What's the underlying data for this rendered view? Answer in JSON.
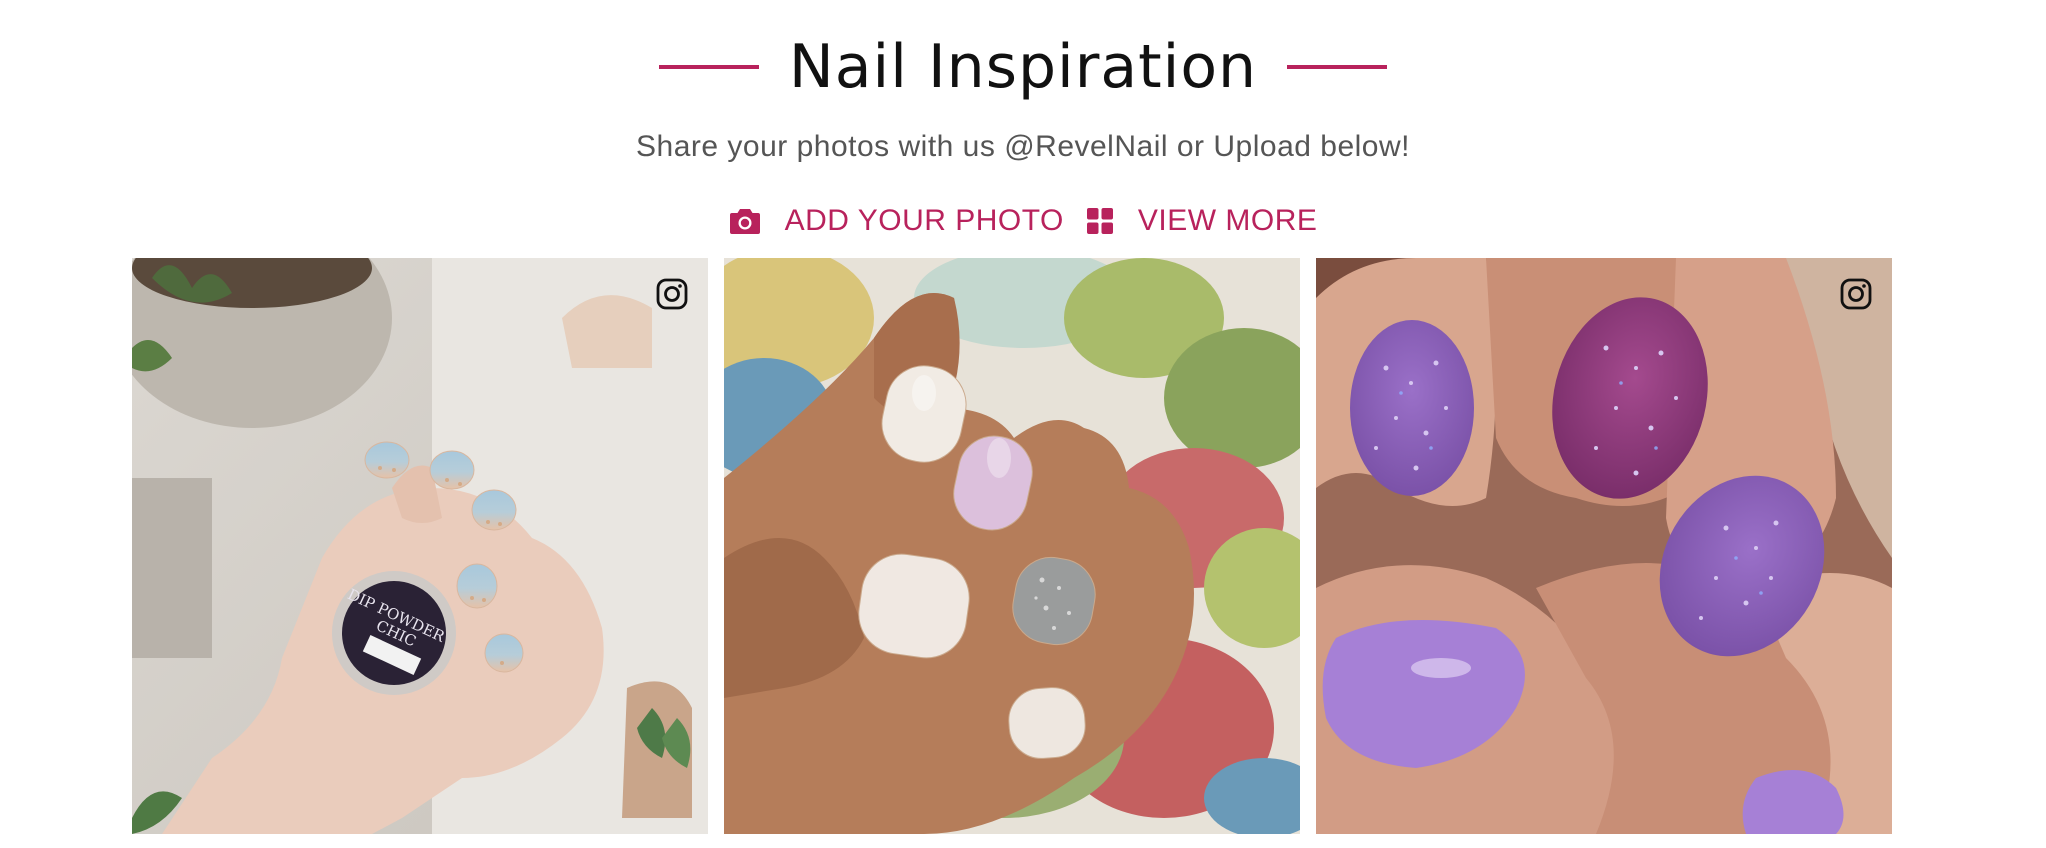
{
  "section": {
    "title": "Nail Inspiration",
    "subtitle": "Share your photos with us @RevelNail or Upload below!",
    "accent_color": "#b8225c"
  },
  "actions": [
    {
      "label": "ADD YOUR PHOTO",
      "icon": "camera-icon"
    },
    {
      "label": "VIEW MORE",
      "icon": "grid-icon"
    }
  ],
  "gallery": {
    "photos": [
      {
        "subject": "hand holding dip powder jar, light blue nails with glitter ombre",
        "jar_label_line1": "DIP POWDER",
        "jar_label_line2": "CHIC",
        "badge": "instagram-icon"
      },
      {
        "subject": "hand with white, lilac and silver glitter nails over floral rug"
      },
      {
        "subject": "hand with purple glitter and lavender nails",
        "badge": "instagram-icon"
      }
    ]
  }
}
